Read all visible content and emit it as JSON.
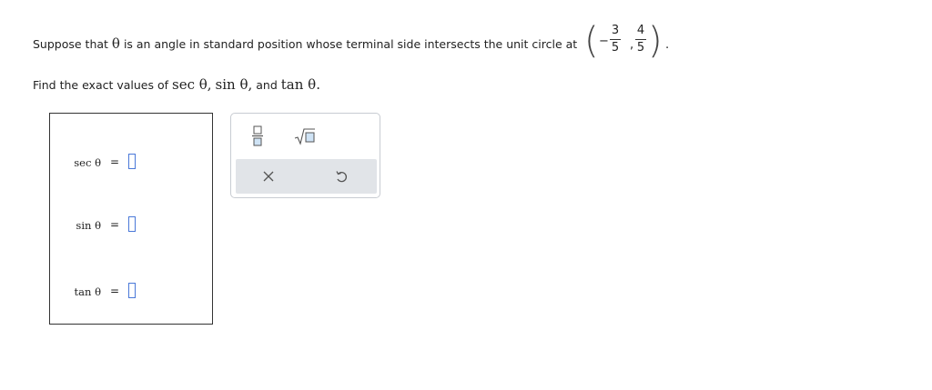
{
  "prompt": {
    "line1_before": "Suppose that",
    "theta": "θ",
    "line1_after": "is an angle in standard position whose terminal side intersects the unit circle at",
    "point": {
      "minus": "−",
      "x_num": "3",
      "x_den": "5",
      "comma": ",",
      "y_num": "4",
      "y_den": "5",
      "period": "."
    },
    "line2_find": "Find the exact values of",
    "sec": "sec θ,",
    "sin": "sin θ,",
    "and": "and",
    "tan": "tan θ."
  },
  "answers": [
    {
      "label": "sec θ",
      "equals": "=",
      "value": ""
    },
    {
      "label": "sin θ",
      "equals": "=",
      "value": ""
    },
    {
      "label": "tan θ",
      "equals": "=",
      "value": ""
    }
  ],
  "palette": {
    "buttons": [
      "fraction-icon",
      "square-root-icon"
    ],
    "actions": [
      "clear-icon",
      "undo-icon"
    ],
    "accent": "#4a78d8",
    "bar_color": "#e1e4e8"
  }
}
